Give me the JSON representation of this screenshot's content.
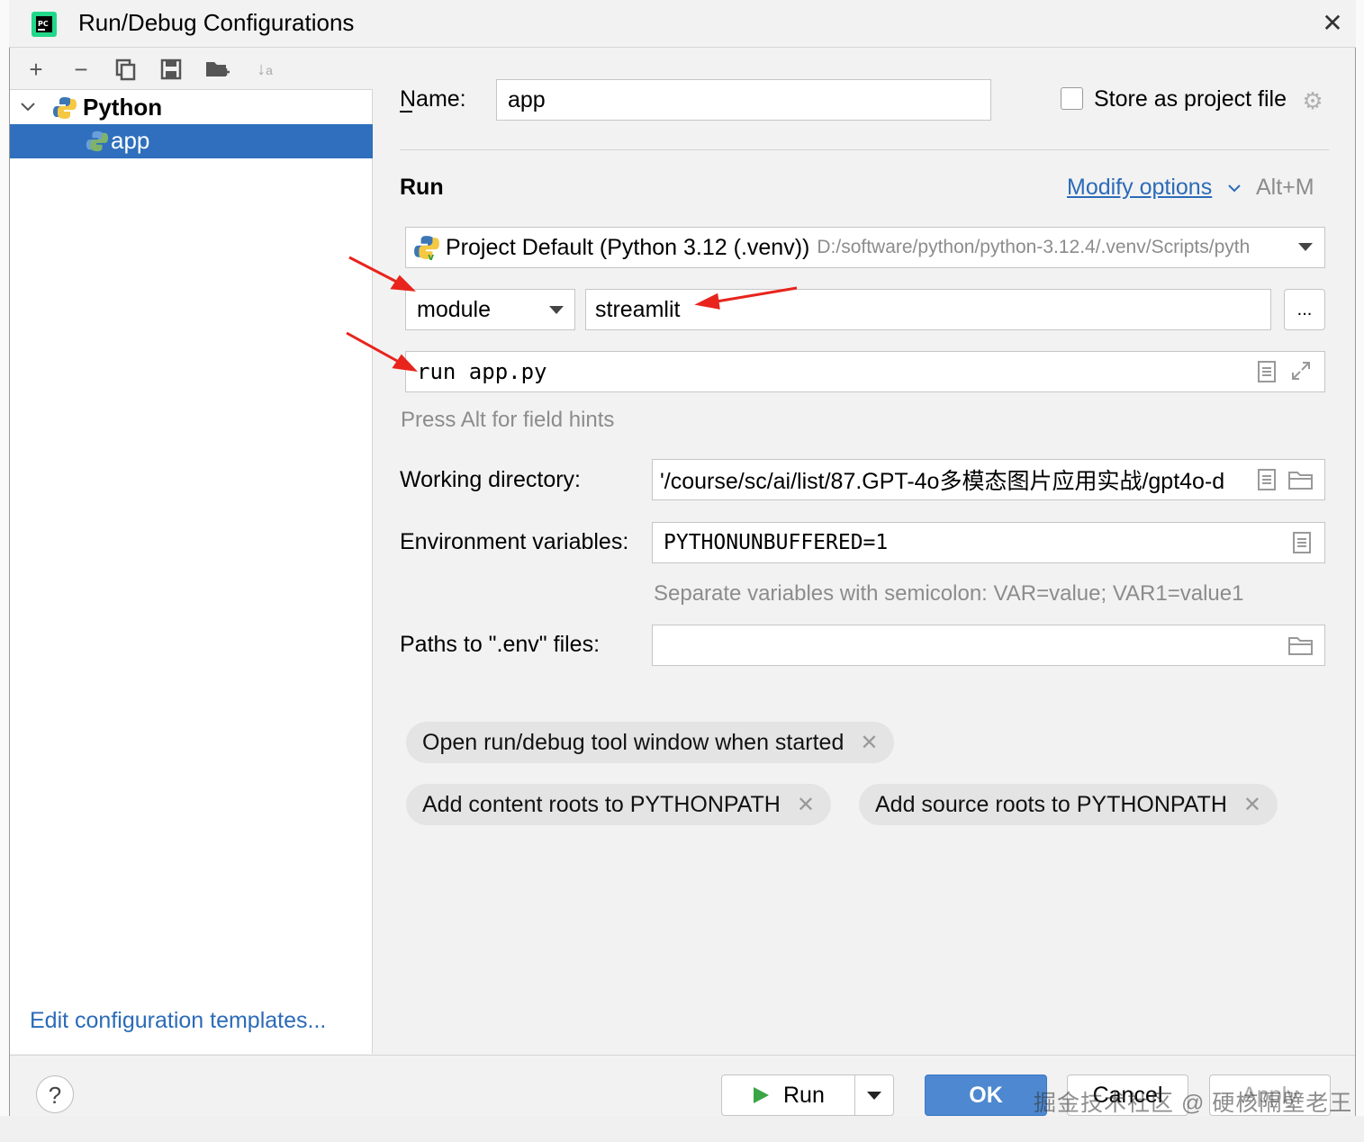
{
  "window": {
    "title": "Run/Debug Configurations"
  },
  "toolbar": {
    "icons": [
      "add-icon",
      "remove-icon",
      "copy-icon",
      "save-icon",
      "new-folder-icon",
      "sort-icon"
    ]
  },
  "tree": {
    "group": "Python",
    "item": "app"
  },
  "left_footer": {
    "edit_templates": "Edit configuration templates..."
  },
  "form": {
    "name_label": "Name:",
    "name_value": "app",
    "store_label": "Store as project file",
    "run_section": "Run",
    "modify_options": "Modify options",
    "modify_shortcut": "Alt+M",
    "interpreter_name": "Project Default (Python 3.12 (.venv))",
    "interpreter_path": "D:/software/python/python-3.12.4/.venv/Scripts/pyth",
    "run_type": "module",
    "module_name": "streamlit",
    "browse_label": "...",
    "parameters": "run app.py",
    "field_hint": "Press Alt for field hints",
    "workdir_label": "Working directory:",
    "workdir_value": "ʹ/course/sc/ai/list/87.GPT-4o多模态图片应用实战/gpt4o-d",
    "env_label": "Environment variables:",
    "env_value": "PYTHONUNBUFFERED=1",
    "env_hint": "Separate variables with semicolon: VAR=value; VAR1=value1",
    "dotenv_label": "Paths to \".env\" files:",
    "dotenv_value": ""
  },
  "chips": [
    "Open run/debug tool window when started",
    "Add content roots to PYTHONPATH",
    "Add source roots to PYTHONPATH"
  ],
  "buttons": {
    "help": "?",
    "run": "Run",
    "ok": "OK",
    "cancel": "Cancel",
    "apply": "Apply"
  },
  "watermark": "掘金技术社区 @ 硬核隔壁老王",
  "colors": {
    "accent": "#2f6fbd",
    "link": "#2b6bb7",
    "annotation_arrow": "#e8241c"
  }
}
